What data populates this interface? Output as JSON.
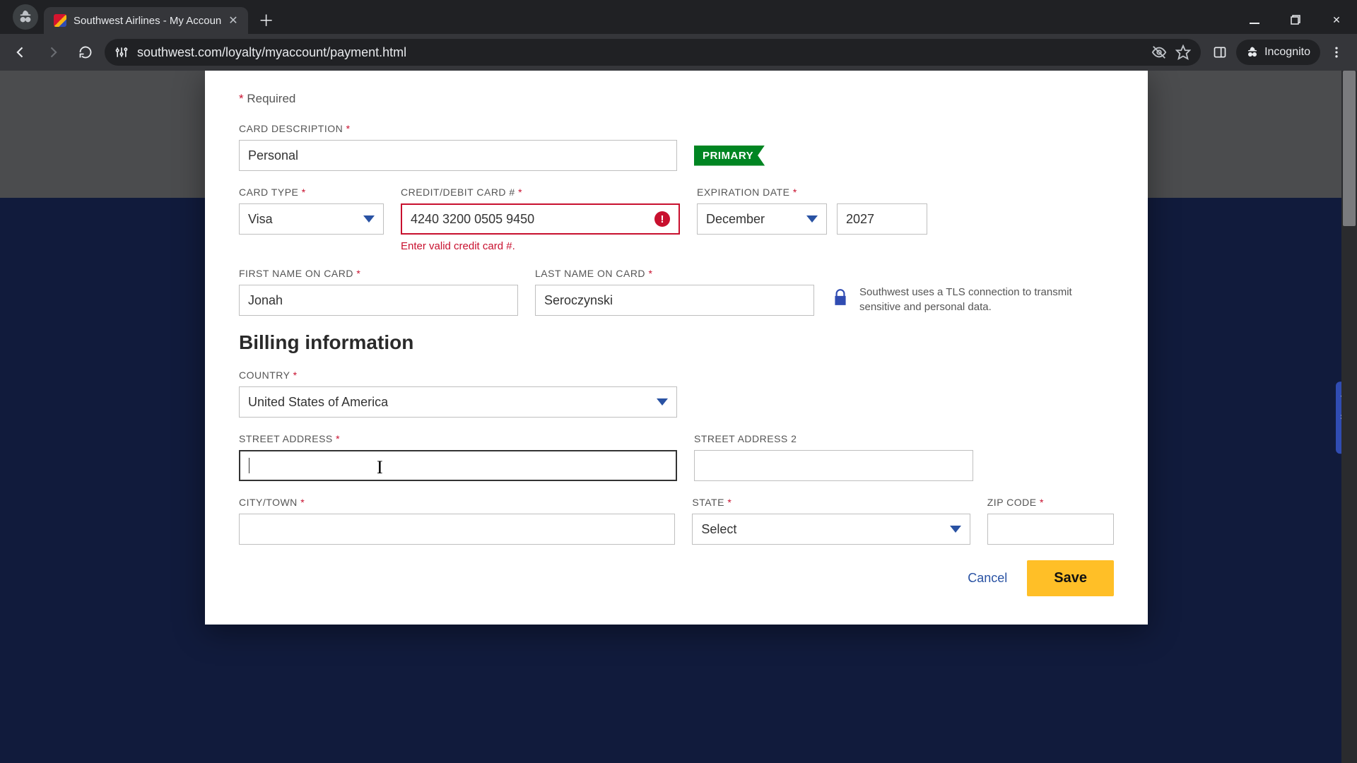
{
  "browser": {
    "tab_title": "Southwest Airlines - My Accoun",
    "url": "southwest.com/loyalty/myaccount/payment.html",
    "incognito_label": "Incognito"
  },
  "form": {
    "required_note": "Required",
    "card_description": {
      "label": "CARD DESCRIPTION",
      "value": "Personal"
    },
    "primary_flag": "PRIMARY",
    "card_type": {
      "label": "CARD TYPE",
      "value": "Visa"
    },
    "card_number": {
      "label": "CREDIT/DEBIT CARD #",
      "value": "4240 3200 0505 9450",
      "error": "Enter valid credit card #."
    },
    "expiration": {
      "label": "EXPIRATION DATE",
      "month": "December",
      "year": "2027"
    },
    "first_name": {
      "label": "FIRST NAME ON CARD",
      "value": "Jonah"
    },
    "last_name": {
      "label": "LAST NAME ON CARD",
      "value": "Seroczynski"
    },
    "tls_note": "Southwest uses a TLS connection to transmit sensitive and personal data.",
    "billing_heading": "Billing information",
    "country": {
      "label": "COUNTRY",
      "value": "United States of America"
    },
    "street1": {
      "label": "STREET ADDRESS",
      "value": ""
    },
    "street2": {
      "label": "STREET ADDRESS 2",
      "value": ""
    },
    "city": {
      "label": "CITY/TOWN",
      "value": ""
    },
    "state": {
      "label": "STATE",
      "value": "Select"
    },
    "zip": {
      "label": "ZIP CODE",
      "value": ""
    },
    "cancel": "Cancel",
    "save": "Save"
  },
  "feedback": "Feedback"
}
